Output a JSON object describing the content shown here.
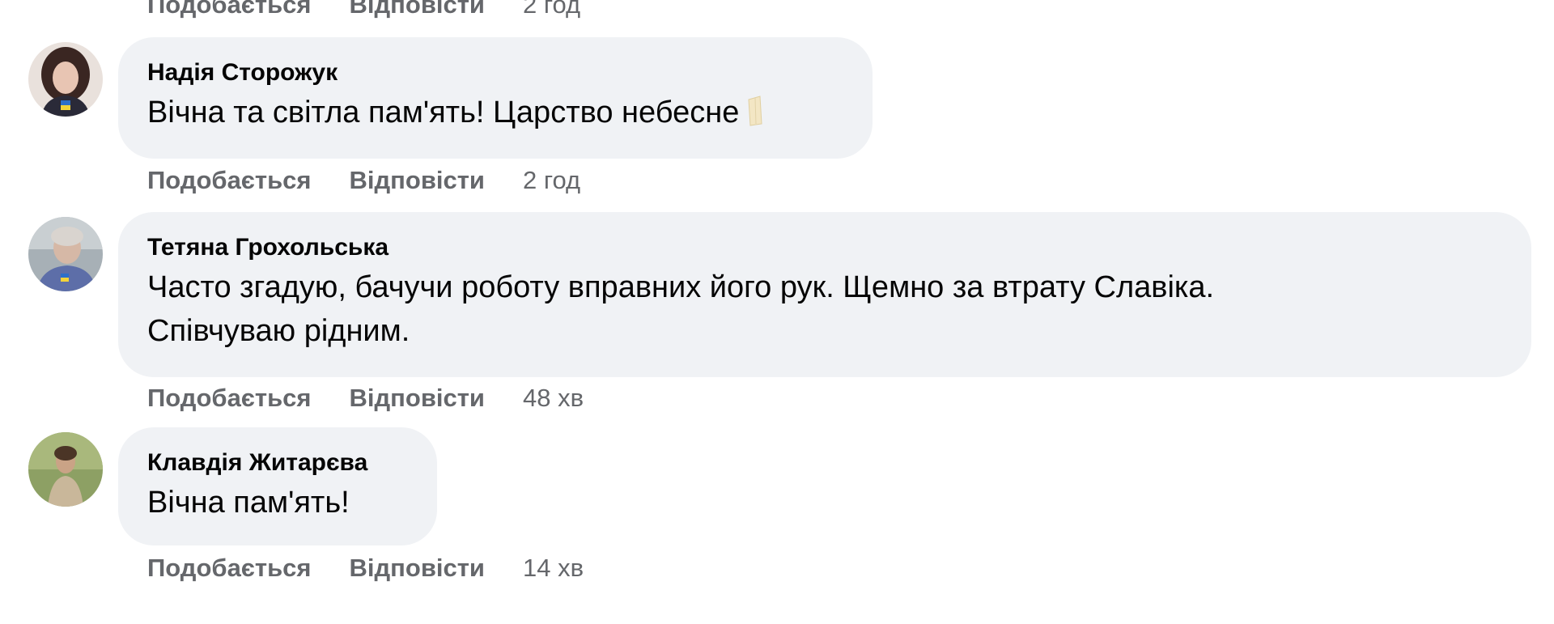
{
  "actions": {
    "like_label": "Подобається",
    "reply_label": "Відповісти"
  },
  "top_partial": {
    "time": "2 год"
  },
  "comments": [
    {
      "author": "Надія Сторожук",
      "lines": [
        "Вічна та світла пам'ять! Царство небесне"
      ],
      "emoji": "folded-hands-emoji",
      "time": "2 год"
    },
    {
      "author": "Тетяна Грохольська",
      "lines": [
        "Часто згадую, бачучи роботу вправних його рук. Щемно за втрату Славіка.",
        "Співчуваю рідним."
      ],
      "time": "48 хв"
    },
    {
      "author": "Клавдія Житарєва",
      "lines": [
        "Вічна пам'ять!"
      ],
      "time": "14 хв"
    }
  ],
  "colors": {
    "bubble_bg": "#f0f2f5",
    "action_text": "#65676b",
    "primary_text": "#050505"
  }
}
